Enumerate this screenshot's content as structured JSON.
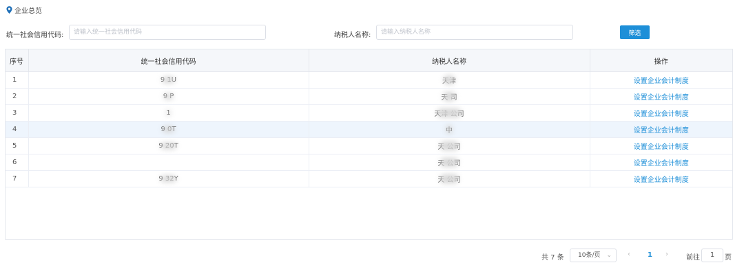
{
  "breadcrumb": {
    "icon": "location-pin-icon",
    "title": "企业总览"
  },
  "search": {
    "credit_code_label": "统一社会信用代码:",
    "credit_code_placeholder": "请输入统一社会信用代码",
    "taxpayer_label": "纳税人名称:",
    "taxpayer_placeholder": "请输入纳税人名称",
    "filter_button": "筛选"
  },
  "table": {
    "headers": [
      "序号",
      "统一社会信用代码",
      "纳税人名称",
      "操作"
    ],
    "rows": [
      {
        "idx": "1",
        "code": "9                1U",
        "name": "天津                ",
        "action": "设置企业会计制度"
      },
      {
        "idx": "2",
        "code": "9                P",
        "name": "天                 司",
        "action": "设置企业会计制度"
      },
      {
        "idx": "3",
        "code": "1                 ",
        "name": "天津           公司",
        "action": "设置企业会计制度"
      },
      {
        "idx": "4",
        "code": "9                0T",
        "name": "中                  ",
        "action": "设置企业会计制度"
      },
      {
        "idx": "5",
        "code": "9                20T",
        "name": "天                公司",
        "action": "设置企业会计制度"
      },
      {
        "idx": "6",
        "code": "                  ",
        "name": "天               公司",
        "action": "设置企业会计制度"
      },
      {
        "idx": "7",
        "code": "9                32Y",
        "name": "天                 公司",
        "action": "设置企业会计制度"
      }
    ],
    "highlighted_row": 3
  },
  "pagination": {
    "total": "共 7 条",
    "page_size": "10条/页",
    "prev": "‹",
    "current": "1",
    "next": "›",
    "goto_label": "前往",
    "goto_value": "1",
    "page_suffix": "页"
  },
  "colors": {
    "accent": "#1e8fd8",
    "header_bg": "#f5f7fa",
    "highlight_row": "#eef5fd"
  }
}
